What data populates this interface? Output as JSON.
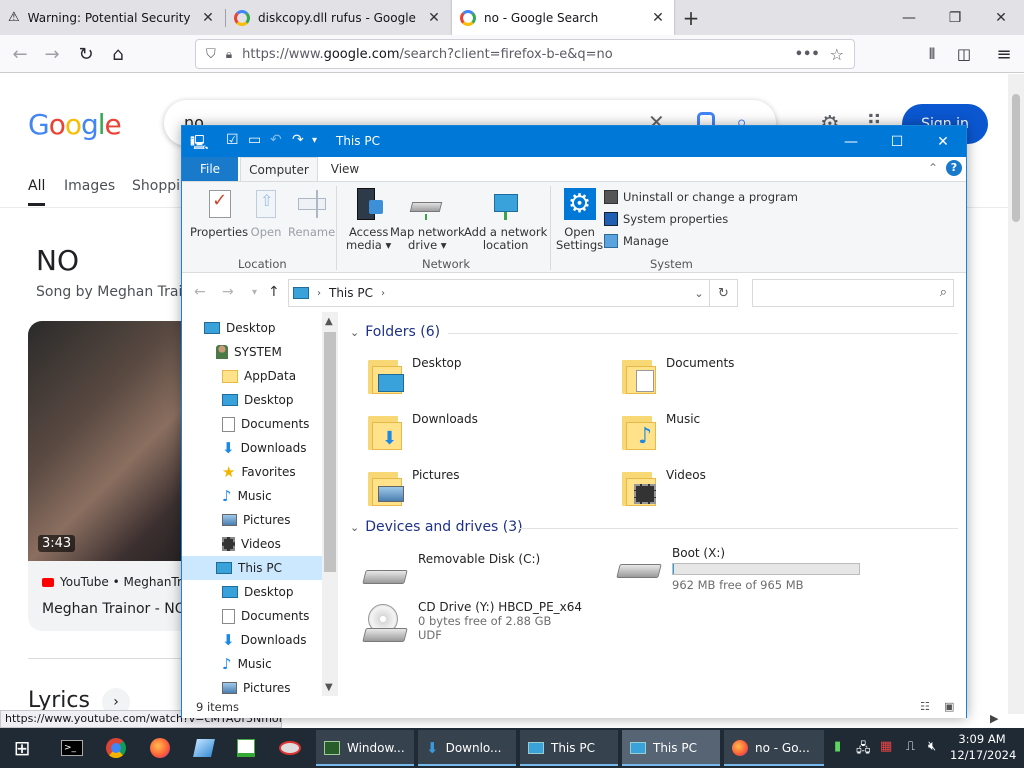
{
  "browser": {
    "tabs": [
      {
        "title": "Warning: Potential Security Ri",
        "icon": "warning-icon"
      },
      {
        "title": "diskcopy.dll rufus - Google Sea",
        "icon": "google-icon"
      },
      {
        "title": "no - Google Search",
        "icon": "google-icon",
        "active": true
      }
    ],
    "url_prefix": "https://www.",
    "url_domain": "google.com",
    "url_rest": "/search?client=firefox-b-e&q=no",
    "status_url": "https://www.youtube.com/watch?v=cMTAUr3Nmof"
  },
  "google": {
    "logo": "Google",
    "query": "no",
    "sign_in": "Sign in",
    "tabs": [
      "All",
      "Images",
      "Shoppin"
    ],
    "kp_title": "NO",
    "kp_subtitle": "Song by Meghan Traino",
    "video": {
      "duration": "3:43",
      "source": "YouTube • MeghanTra",
      "title": "Meghan Trainor - NO"
    },
    "lyrics": "Lyrics"
  },
  "explorer": {
    "title": "This PC",
    "menu_tabs": [
      "File",
      "Computer",
      "View"
    ],
    "ribbon": {
      "location": {
        "label": "Location",
        "buttons": [
          "Properties",
          "Open",
          "Rename"
        ]
      },
      "network": {
        "label": "Network",
        "buttons": [
          [
            "Access",
            "media ▾"
          ],
          [
            "Map network",
            "drive ▾"
          ],
          [
            "Add a network",
            "location"
          ]
        ]
      },
      "system": {
        "label": "System",
        "open_settings": [
          "Open",
          "Settings"
        ],
        "items": [
          "Uninstall or change a program",
          "System properties",
          "Manage"
        ]
      }
    },
    "address": {
      "crumb": "This PC"
    },
    "nav": [
      {
        "label": "Desktop",
        "icon": "desktop-icon",
        "indent": 0
      },
      {
        "label": "SYSTEM",
        "icon": "user-icon",
        "indent": 1
      },
      {
        "label": "AppData",
        "icon": "folder-icon",
        "indent": 2
      },
      {
        "label": "Desktop",
        "icon": "desktop-icon",
        "indent": 2
      },
      {
        "label": "Documents",
        "icon": "documents-icon",
        "indent": 2
      },
      {
        "label": "Downloads",
        "icon": "downloads-icon",
        "indent": 2
      },
      {
        "label": "Favorites",
        "icon": "star-icon",
        "indent": 2
      },
      {
        "label": "Music",
        "icon": "music-icon",
        "indent": 2
      },
      {
        "label": "Pictures",
        "icon": "pictures-icon",
        "indent": 2
      },
      {
        "label": "Videos",
        "icon": "videos-icon",
        "indent": 2
      },
      {
        "label": "This PC",
        "icon": "computer-icon",
        "indent": 1,
        "selected": true
      },
      {
        "label": "Desktop",
        "icon": "desktop-icon",
        "indent": 2
      },
      {
        "label": "Documents",
        "icon": "documents-icon",
        "indent": 2
      },
      {
        "label": "Downloads",
        "icon": "downloads-icon",
        "indent": 2
      },
      {
        "label": "Music",
        "icon": "music-icon",
        "indent": 2
      },
      {
        "label": "Pictures",
        "icon": "pictures-icon",
        "indent": 2
      }
    ],
    "folders_header": "Folders (6)",
    "folders": [
      "Desktop",
      "Documents",
      "Downloads",
      "Music",
      "Pictures",
      "Videos"
    ],
    "drives_header": "Devices and drives (3)",
    "drives": {
      "removable": {
        "name": "Removable Disk (C:)"
      },
      "boot": {
        "name": "Boot (X:)",
        "free": "962 MB free of 965 MB",
        "used_fraction": 0.003
      },
      "cd": {
        "name": "CD Drive (Y:) HBCD_PE_x64",
        "free": "0 bytes free of 2.88 GB",
        "fs": "UDF"
      }
    },
    "status_count": "9 items"
  },
  "taskbar": {
    "tasks": [
      {
        "label": "Window...",
        "icon": "task-window-icon"
      },
      {
        "label": "Downlo...",
        "icon": "downloads-icon"
      },
      {
        "label": "This PC",
        "icon": "computer-icon"
      },
      {
        "label": "This PC",
        "icon": "computer-icon",
        "active": true
      },
      {
        "label": "no - Go...",
        "icon": "firefox-icon"
      }
    ],
    "time": "3:09 AM",
    "date": "12/17/2024"
  },
  "colors": {
    "explorer_accent": "#0078d7",
    "google_blue": "#0b57d0",
    "taskbar": "#1f2a35"
  }
}
